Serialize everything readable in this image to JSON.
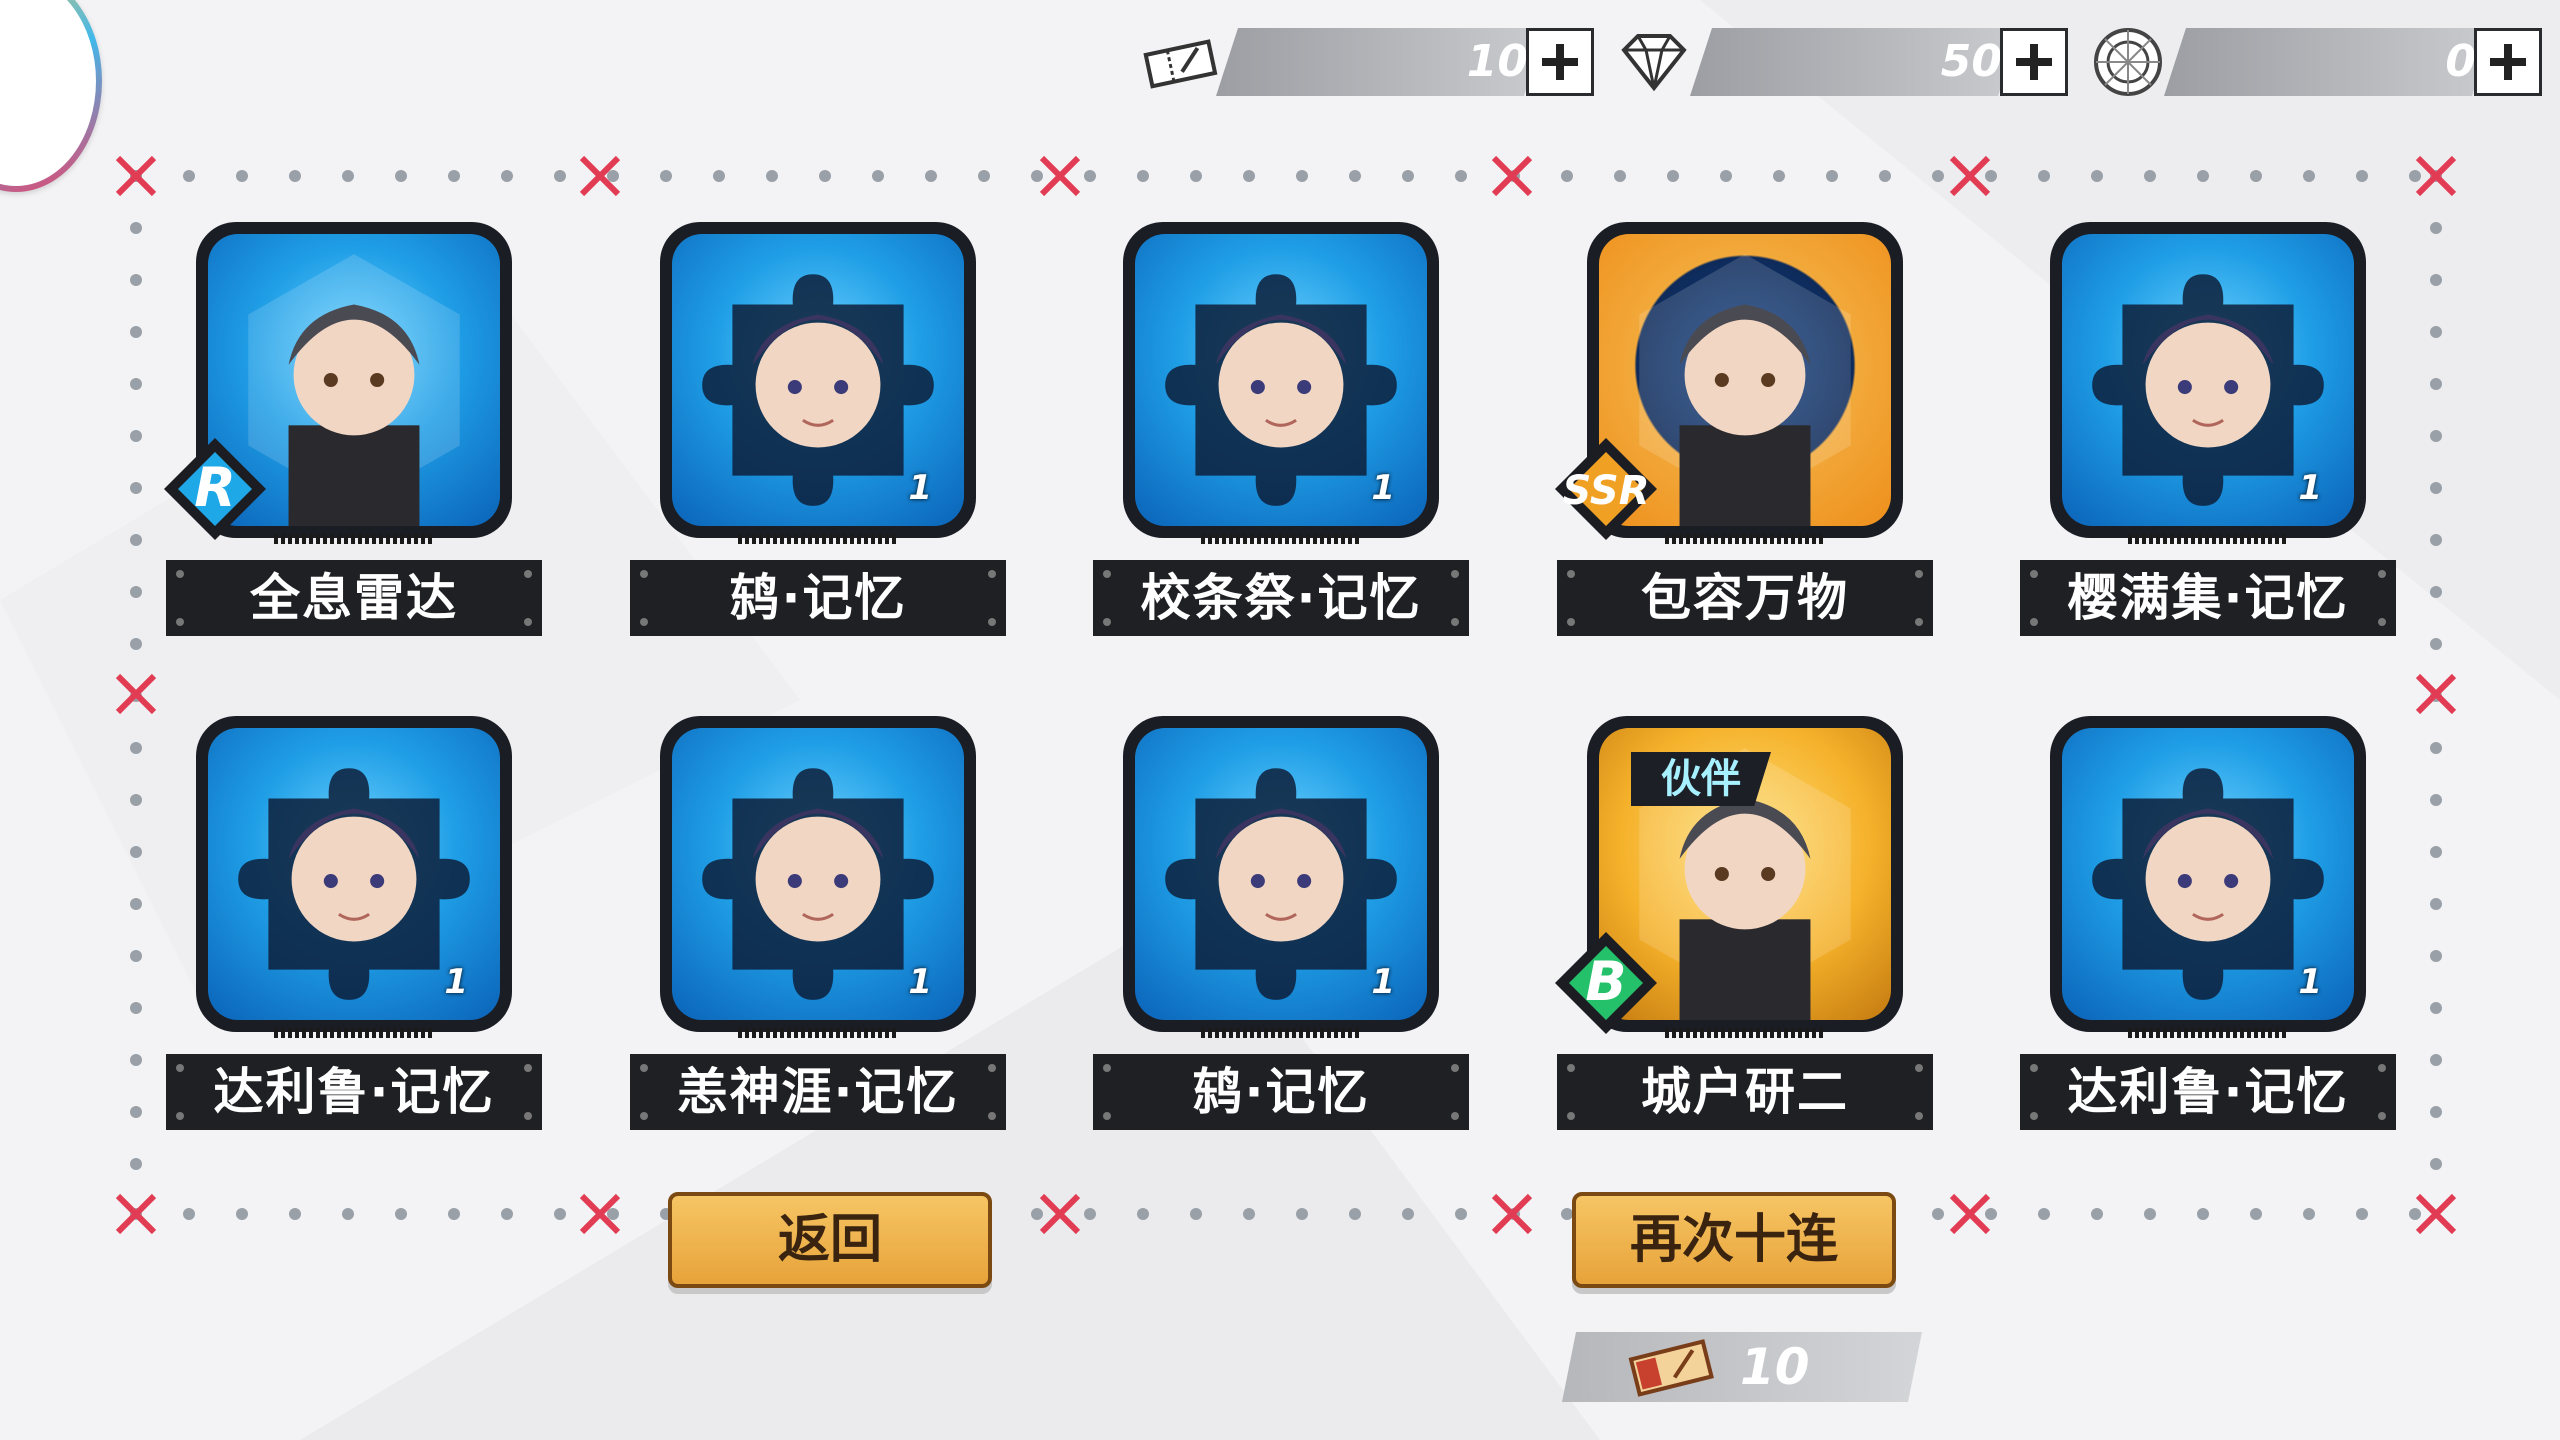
{
  "currencies": [
    {
      "icon": "ticket-icon",
      "value": "10"
    },
    {
      "icon": "diamond-icon",
      "value": "50"
    },
    {
      "icon": "crystal-icon",
      "value": "0"
    }
  ],
  "cards": [
    {
      "name": "全息雷达",
      "rarity": "R",
      "count": ""
    },
    {
      "name": "鸫·记忆",
      "rarity": "",
      "count": "1"
    },
    {
      "name": "校条祭·记忆",
      "rarity": "",
      "count": "1"
    },
    {
      "name": "包容万物",
      "rarity": "SSR",
      "count": ""
    },
    {
      "name": "樱满集·记忆",
      "rarity": "",
      "count": "1"
    },
    {
      "name": "达利鲁·记忆",
      "rarity": "",
      "count": "1"
    },
    {
      "name": "恙神涯·记忆",
      "rarity": "",
      "count": "1"
    },
    {
      "name": "鸫·记忆",
      "rarity": "",
      "count": "1"
    },
    {
      "name": "城户研二",
      "rarity": "B",
      "count": "",
      "tag": "伙伴"
    },
    {
      "name": "达利鲁·记忆",
      "rarity": "",
      "count": "1"
    }
  ],
  "buttons": {
    "back": "返回",
    "again": "再次十连"
  },
  "cost": {
    "icon": "ticket-icon",
    "value": "10"
  },
  "colors": {
    "accent_red": "#e23b54",
    "button_orange": "#f0b24a",
    "card_blue": "#1f9ee6"
  }
}
